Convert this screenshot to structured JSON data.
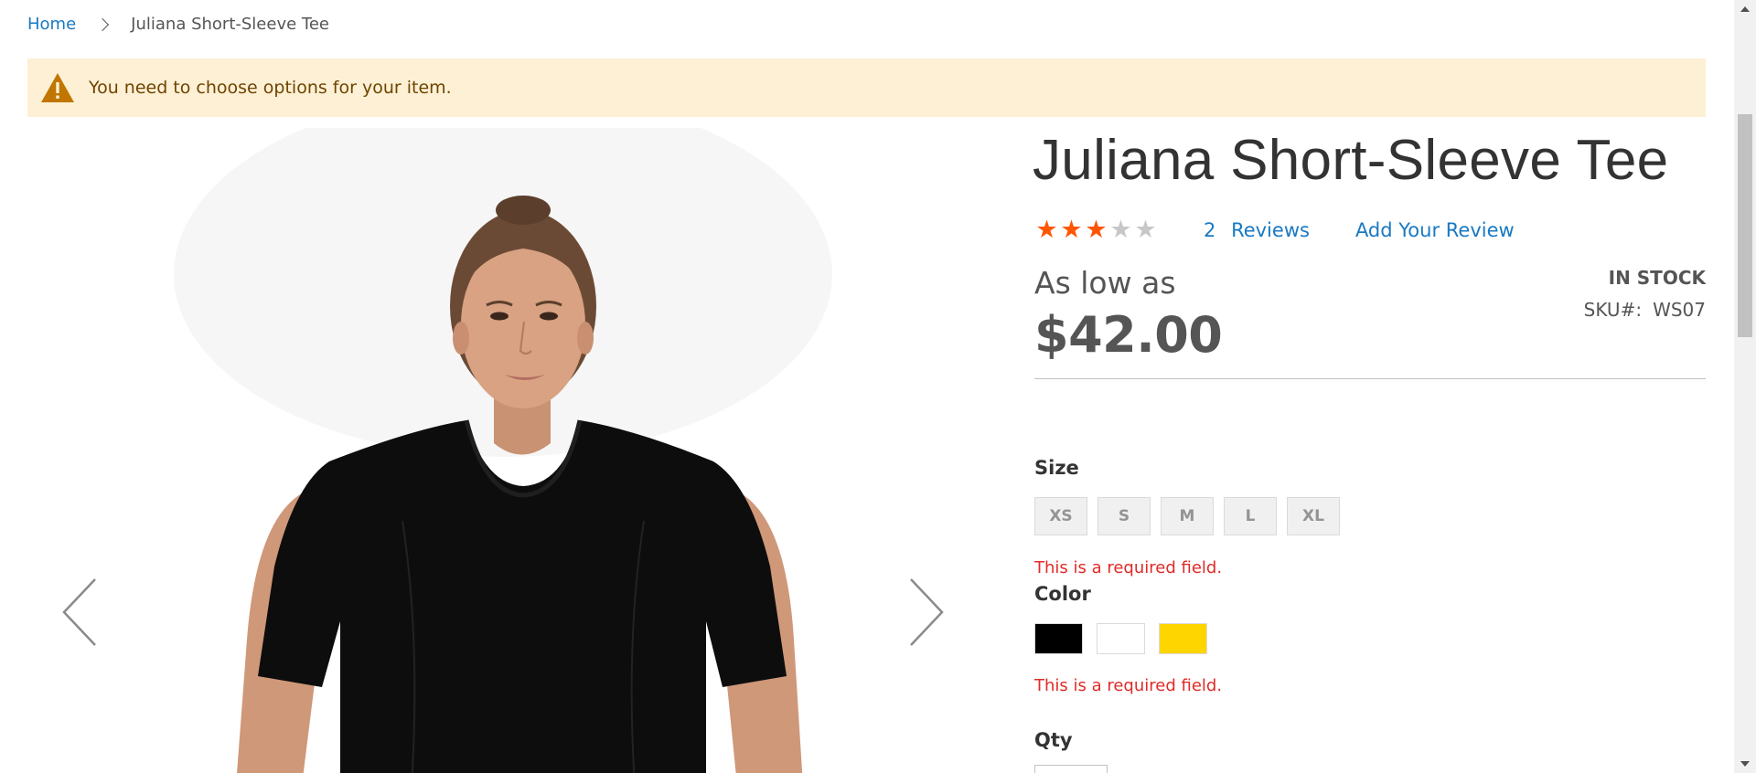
{
  "breadcrumb": {
    "home": "Home",
    "current": "Juliana Short-Sleeve Tee"
  },
  "notice": {
    "icon": "warning-icon",
    "text": "You need to choose options for your item."
  },
  "gallery": {
    "prev_icon": "chevron-left-icon",
    "next_icon": "chevron-right-icon"
  },
  "product": {
    "title": "Juliana Short-Sleeve Tee",
    "rating": {
      "stars_filled": 3,
      "stars_total": 5,
      "star_on_color": "#ff5501",
      "star_off_color": "#c7c7c7"
    },
    "reviews_count": "2",
    "reviews_label": "Reviews",
    "add_review_label": "Add Your Review",
    "as_low_as": "As low as",
    "price": "$42.00",
    "stock": "IN STOCK",
    "sku_label": "SKU#:",
    "sku_value": "WS07"
  },
  "options": {
    "size": {
      "label": "Size",
      "values": [
        "XS",
        "S",
        "M",
        "L",
        "XL"
      ],
      "error": "This is a required field."
    },
    "color": {
      "label": "Color",
      "swatches": [
        {
          "name": "Black",
          "hex": "#000000"
        },
        {
          "name": "White",
          "hex": "#ffffff"
        },
        {
          "name": "Yellow",
          "hex": "#ffd500"
        }
      ],
      "error": "This is a required field."
    },
    "qty": {
      "label": "Qty"
    }
  },
  "colors": {
    "link": "#1979c3",
    "error": "#e02b27",
    "notice_bg": "#fdf0d5",
    "notice_text": "#6f4400"
  }
}
